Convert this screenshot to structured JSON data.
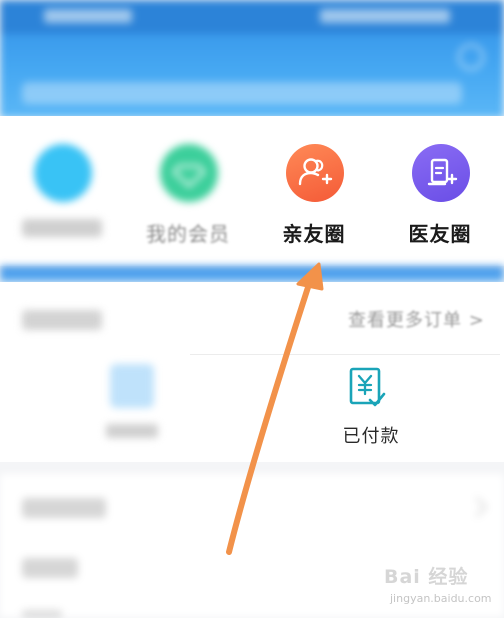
{
  "quick_menu": {
    "items": [
      {
        "label": "",
        "icon": "blurred-circle-icon"
      },
      {
        "label": "我的会员",
        "icon": "diamond-icon"
      },
      {
        "label": "亲友圈",
        "icon": "add-friend-icon"
      },
      {
        "label": "医友圈",
        "icon": "add-doctor-icon"
      }
    ]
  },
  "orders": {
    "more_link": "查看更多订单 >",
    "paid_label": "已付款"
  },
  "watermark": {
    "main": "Bai 经验",
    "sub": "jingyan.baidu.com"
  },
  "colors": {
    "header_blue": "#3d92e6",
    "friend_orange": "#f45a37",
    "doctor_purple": "#6a4ee6",
    "member_green": "#3ccf9b",
    "arrow_orange": "#f2924a",
    "paid_icon_teal": "#1aa4b8"
  }
}
